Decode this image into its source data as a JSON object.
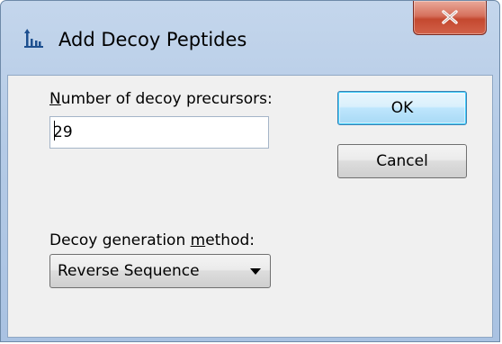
{
  "window": {
    "title": "Add Decoy Peptides",
    "icon": "peptide-chart-icon",
    "close_icon": "close-x-icon"
  },
  "form": {
    "precursors_label_accel": "N",
    "precursors_label_rest": "umber of decoy precursors:",
    "precursors_value": "29",
    "method_label_before": "Decoy generation ",
    "method_label_accel": "m",
    "method_label_after": "ethod:",
    "method_selected": "Reverse Sequence",
    "method_arrow_icon": "dropdown-arrow-icon"
  },
  "buttons": {
    "ok_label": "OK",
    "cancel_label": "Cancel"
  },
  "colors": {
    "titlebar": "#b5cbe6",
    "close_button": "#c4482f",
    "client_bg": "#f0f0f0",
    "default_button_border": "#3c7fb1"
  }
}
